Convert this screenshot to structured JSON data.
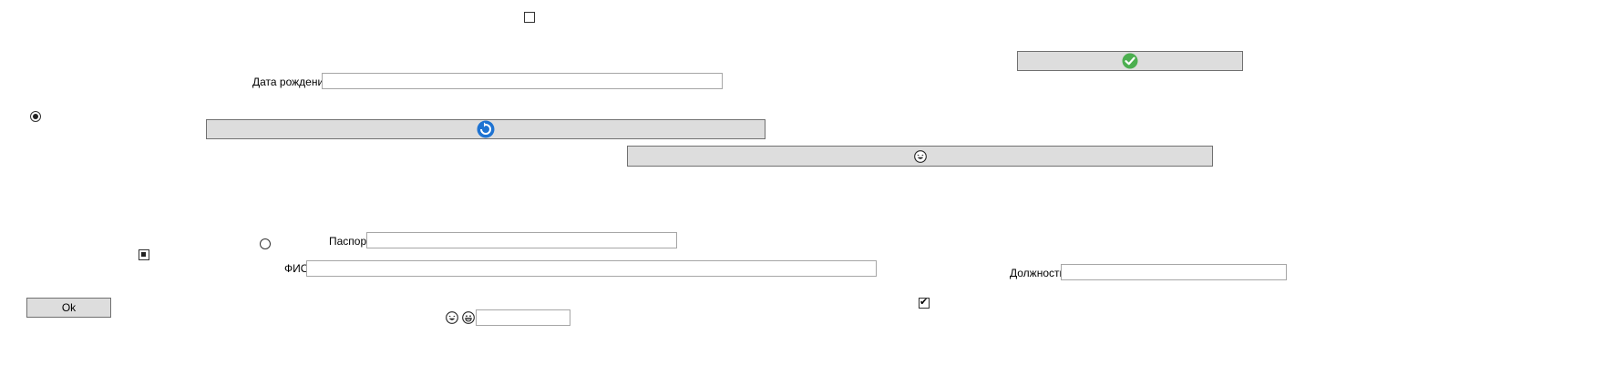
{
  "form": {
    "birth_date_label": "Дата рождения",
    "passport_label": "Паспорт",
    "fio_label": "ФИО",
    "position_label": "Должность",
    "ok_button_label": "Ok",
    "birth_date_value": "",
    "passport_value": "",
    "fio_value": "",
    "position_value": "",
    "small_field_value": ""
  },
  "controls": {
    "top_checkbox_checked": false,
    "radio_left_selected": true,
    "radio_passport_selected": false,
    "bottom_checkbox_checked": true,
    "indeterminate_checkbox": true
  },
  "icons": {
    "button_top": "green-checkmark-icon",
    "button_middle": "blue-refresh-icon",
    "button_lower": "laughing-face-icon",
    "emoji_1": "laughing-face-icon",
    "emoji_2": "grinning-face-icon"
  },
  "colors": {
    "button_bg": "#dddddd",
    "check_green": "#4caf50",
    "refresh_blue": "#1e73d2"
  }
}
